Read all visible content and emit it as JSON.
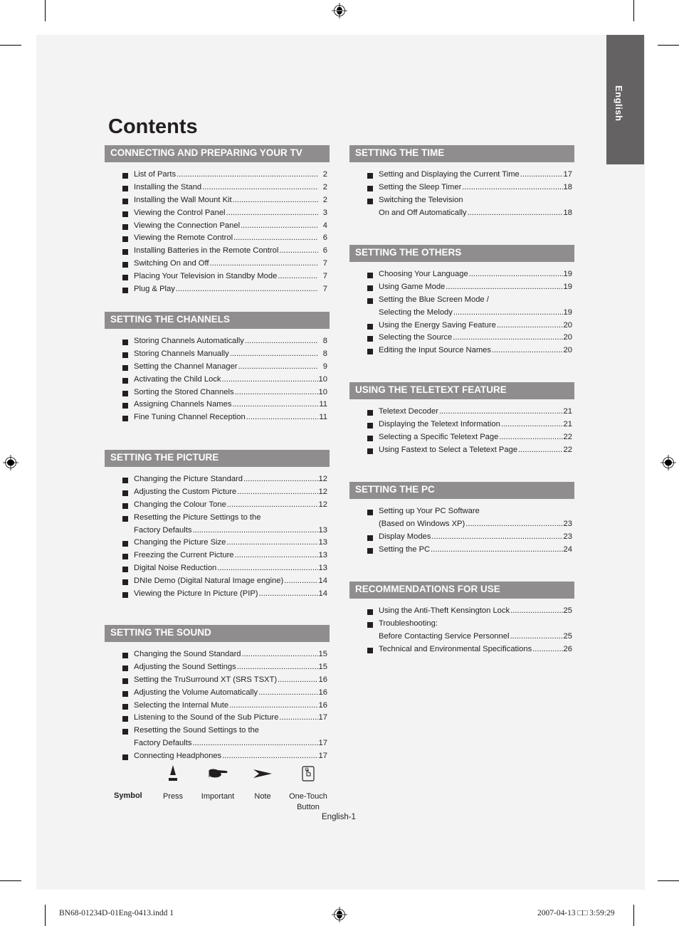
{
  "document": {
    "title": "Contents",
    "language_tab": "English",
    "page_label": "English-1"
  },
  "sections": [
    {
      "heading": "CONNECTING AND PREPARING YOUR TV",
      "entries": [
        {
          "lines": [
            "List of Parts"
          ],
          "page": "2"
        },
        {
          "lines": [
            "Installing the Stand"
          ],
          "page": "2"
        },
        {
          "lines": [
            "Installing the Wall Mount Kit"
          ],
          "page": "2"
        },
        {
          "lines": [
            "Viewing the Control Panel"
          ],
          "page": "3"
        },
        {
          "lines": [
            "Viewing the Connection Panel"
          ],
          "page": "4"
        },
        {
          "lines": [
            "Viewing the Remote Control"
          ],
          "page": "6"
        },
        {
          "lines": [
            "Installing Batteries in the Remote Control"
          ],
          "page": "6"
        },
        {
          "lines": [
            "Switching On and Off"
          ],
          "page": "7"
        },
        {
          "lines": [
            "Placing Your Television in Standby Mode"
          ],
          "page": "7"
        },
        {
          "lines": [
            "Plug & Play"
          ],
          "page": "7"
        }
      ]
    },
    {
      "heading": "SETTING THE CHANNELS",
      "entries": [
        {
          "lines": [
            "Storing Channels Automatically"
          ],
          "page": "8"
        },
        {
          "lines": [
            "Storing Channels Manually"
          ],
          "page": "8"
        },
        {
          "lines": [
            "Setting the Channel Manager"
          ],
          "page": "9"
        },
        {
          "lines": [
            "Activating the Child Lock"
          ],
          "page": "10"
        },
        {
          "lines": [
            "Sorting the Stored Channels"
          ],
          "page": "10"
        },
        {
          "lines": [
            "Assigning Channels Names"
          ],
          "page": "11"
        },
        {
          "lines": [
            "Fine Tuning Channel Reception"
          ],
          "page": "11"
        }
      ]
    },
    {
      "heading": "SETTING THE PICTURE",
      "entries": [
        {
          "lines": [
            "Changing the Picture Standard"
          ],
          "page": "12"
        },
        {
          "lines": [
            "Adjusting the Custom Picture"
          ],
          "page": "12"
        },
        {
          "lines": [
            "Changing the Colour Tone"
          ],
          "page": "12"
        },
        {
          "lines": [
            "Resetting the Picture Settings to the",
            "Factory Defaults"
          ],
          "page": "13"
        },
        {
          "lines": [
            "Changing the Picture Size"
          ],
          "page": "13"
        },
        {
          "lines": [
            "Freezing the Current Picture"
          ],
          "page": "13"
        },
        {
          "lines": [
            "Digital Noise Reduction"
          ],
          "page": "13"
        },
        {
          "lines": [
            "DNIe Demo (Digital Natural Image engine)"
          ],
          "page": "14"
        },
        {
          "lines": [
            "Viewing the Picture In Picture (PIP)"
          ],
          "page": "14"
        }
      ]
    },
    {
      "heading": "SETTING THE SOUND",
      "entries": [
        {
          "lines": [
            "Changing the Sound Standard"
          ],
          "page": "15"
        },
        {
          "lines": [
            "Adjusting the Sound Settings"
          ],
          "page": "15"
        },
        {
          "lines": [
            "Setting the TruSurround XT (SRS TSXT)"
          ],
          "page": "16"
        },
        {
          "lines": [
            "Adjusting the Volume Automatically"
          ],
          "page": "16"
        },
        {
          "lines": [
            "Selecting the Internal Mute"
          ],
          "page": "16"
        },
        {
          "lines": [
            "Listening to the Sound of the Sub Picture"
          ],
          "page": "17"
        },
        {
          "lines": [
            "Resetting the Sound Settings to the",
            "Factory Defaults"
          ],
          "page": "17"
        },
        {
          "lines": [
            "Connecting Headphones"
          ],
          "page": "17"
        }
      ]
    },
    {
      "heading": "SETTING THE TIME",
      "entries": [
        {
          "lines": [
            "Setting and Displaying the Current Time"
          ],
          "page": "17"
        },
        {
          "lines": [
            "Setting the Sleep Timer"
          ],
          "page": "18"
        },
        {
          "lines": [
            "Switching the Television",
            "On and Off Automatically"
          ],
          "page": "18"
        }
      ]
    },
    {
      "heading": "SETTING THE OTHERS",
      "entries": [
        {
          "lines": [
            "Choosing Your Language"
          ],
          "page": "19"
        },
        {
          "lines": [
            "Using Game Mode"
          ],
          "page": "19"
        },
        {
          "lines": [
            "Setting the Blue Screen Mode /",
            "Selecting the Melody"
          ],
          "page": "19"
        },
        {
          "lines": [
            "Using the Energy Saving Feature"
          ],
          "page": "20"
        },
        {
          "lines": [
            "Selecting the Source"
          ],
          "page": "20"
        },
        {
          "lines": [
            "Editing the Input Source Names"
          ],
          "page": "20"
        }
      ]
    },
    {
      "heading": "USING THE TELETEXT FEATURE",
      "entries": [
        {
          "lines": [
            "Teletext Decoder"
          ],
          "page": "21"
        },
        {
          "lines": [
            "Displaying the Teletext Information"
          ],
          "page": "21"
        },
        {
          "lines": [
            "Selecting a Specific Teletext Page"
          ],
          "page": "22"
        },
        {
          "lines": [
            "Using Fastext to Select a Teletext Page"
          ],
          "page": "22"
        }
      ]
    },
    {
      "heading": "SETTING THE PC",
      "entries": [
        {
          "lines": [
            "Setting up Your PC Software",
            "(Based on Windows XP)"
          ],
          "page": "23"
        },
        {
          "lines": [
            "Display Modes"
          ],
          "page": "23"
        },
        {
          "lines": [
            "Setting the PC"
          ],
          "page": "24"
        }
      ]
    },
    {
      "heading": "RECOMMENDATIONS FOR USE",
      "entries": [
        {
          "lines": [
            "Using the Anti-Theft Kensington Lock"
          ],
          "page": "25"
        },
        {
          "lines": [
            "Troubleshooting:",
            "Before Contacting Service Personnel"
          ],
          "page": "25"
        },
        {
          "lines": [
            "Technical and Environmental Specifications"
          ],
          "page": "26"
        }
      ]
    }
  ],
  "symbol_legend": {
    "title": "Symbol",
    "items": [
      {
        "icon": "press-icon",
        "label": "Press"
      },
      {
        "icon": "important-hand-icon",
        "label": "Important"
      },
      {
        "icon": "note-arrow-icon",
        "label": "Note"
      },
      {
        "icon": "one-touch-button-icon",
        "label": "One-Touch Button"
      }
    ]
  },
  "print_slug": {
    "file": "BN68-01234D-01Eng-0413.indd   1",
    "timestamp": "2007-04-13   □□ 3:59:29"
  }
}
